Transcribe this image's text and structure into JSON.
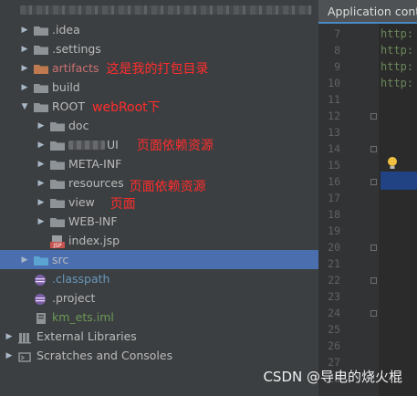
{
  "editor_tab": "Application conte",
  "tree": [
    {
      "label": ".idea",
      "type": "folder",
      "state": "collapsed",
      "color": "normal"
    },
    {
      "label": ".settings",
      "type": "folder",
      "state": "collapsed",
      "color": "normal"
    },
    {
      "label": "artifacts",
      "type": "folder",
      "state": "collapsed",
      "color": "red",
      "annotation": "这是我的打包目录"
    },
    {
      "label": "build",
      "type": "folder",
      "state": "collapsed",
      "color": "normal"
    },
    {
      "label": "ROOT",
      "type": "folder",
      "state": "expanded",
      "color": "normal",
      "annotation": "webRoot下"
    },
    {
      "label": "doc",
      "type": "folder",
      "state": "collapsed",
      "color": "normal"
    },
    {
      "label": "UI",
      "type": "folder",
      "state": "collapsed",
      "color": "normal",
      "annotation": "页面依赖资源"
    },
    {
      "label": "META-INF",
      "type": "folder",
      "state": "collapsed",
      "color": "normal"
    },
    {
      "label": "resources",
      "type": "folder",
      "state": "collapsed",
      "color": "normal",
      "annotation": "页面依赖资源"
    },
    {
      "label": "view",
      "type": "folder",
      "state": "collapsed",
      "color": "normal",
      "annotation": "页面"
    },
    {
      "label": "WEB-INF",
      "type": "folder",
      "state": "collapsed",
      "color": "normal"
    },
    {
      "label": "index.jsp",
      "type": "jsp",
      "color": "normal"
    },
    {
      "label": "src",
      "type": "folder-src",
      "state": "collapsed",
      "color": "normal",
      "selected": true
    },
    {
      "label": ".classpath",
      "type": "eclipse",
      "color": "blue"
    },
    {
      "label": ".project",
      "type": "eclipse",
      "color": "normal"
    },
    {
      "label": "km_ets.iml",
      "type": "iml",
      "color": "green"
    },
    {
      "label": "External Libraries",
      "type": "libs",
      "state": "collapsed",
      "color": "normal"
    },
    {
      "label": "Scratches and Consoles",
      "type": "scratch",
      "state": "collapsed",
      "color": "normal"
    }
  ],
  "line_numbers": [
    "7",
    "8",
    "9",
    "10",
    "11",
    "12",
    "13",
    "14",
    "15",
    "16",
    "17",
    "18",
    "19",
    "20",
    "21",
    "22",
    "23",
    "24",
    "25",
    "26",
    "27",
    "28"
  ],
  "code_lines": [
    "http:",
    "http:",
    "http:",
    "http:"
  ],
  "watermark": "CSDN @导电的烧火棍"
}
